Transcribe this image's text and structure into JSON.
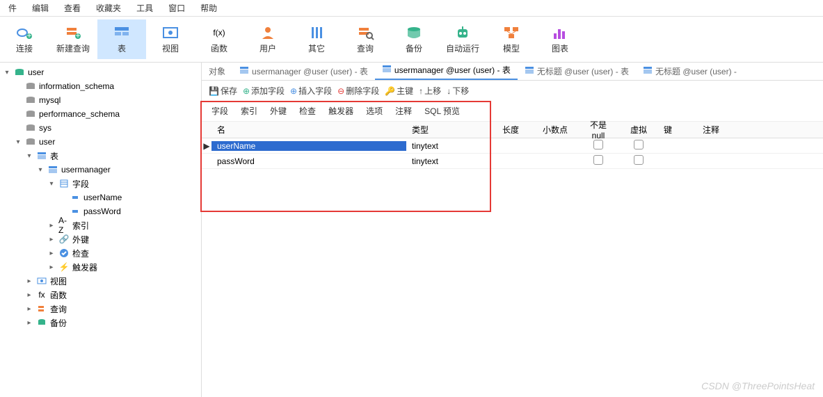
{
  "menu": [
    "文件",
    "编辑",
    "查看",
    "收藏夹",
    "工具",
    "窗口",
    "帮助"
  ],
  "toolbar": [
    {
      "label": "连接",
      "icon": "plug",
      "color": "#4a90e2"
    },
    {
      "label": "新建查询",
      "icon": "plus-doc",
      "color": "#f0803c"
    },
    {
      "label": "表",
      "icon": "table",
      "color": "#4a90e2",
      "active": true
    },
    {
      "label": "视图",
      "icon": "view",
      "color": "#4a90e2"
    },
    {
      "label": "函数",
      "icon": "fx",
      "color": "#4a90e2"
    },
    {
      "label": "用户",
      "icon": "user",
      "color": "#f0803c"
    },
    {
      "label": "其它",
      "icon": "tools",
      "color": "#4a90e2"
    },
    {
      "label": "查询",
      "icon": "query",
      "color": "#f0803c"
    },
    {
      "label": "备份",
      "icon": "backup",
      "color": "#35b38b"
    },
    {
      "label": "自动运行",
      "icon": "robot",
      "color": "#35b38b"
    },
    {
      "label": "模型",
      "icon": "model",
      "color": "#f0803c"
    },
    {
      "label": "图表",
      "icon": "chart",
      "color": "#b74de0"
    }
  ],
  "tree": [
    {
      "label": "user",
      "icon": "db-green",
      "indent": 0,
      "arrow": "▾"
    },
    {
      "label": "information_schema",
      "icon": "db",
      "indent": 1,
      "arrow": ""
    },
    {
      "label": "mysql",
      "icon": "db",
      "indent": 1,
      "arrow": ""
    },
    {
      "label": "performance_schema",
      "icon": "db",
      "indent": 1,
      "arrow": ""
    },
    {
      "label": "sys",
      "icon": "db",
      "indent": 1,
      "arrow": ""
    },
    {
      "label": "user",
      "icon": "db",
      "indent": 1,
      "arrow": "▾"
    },
    {
      "label": "表",
      "icon": "table",
      "indent": 2,
      "arrow": "▾"
    },
    {
      "label": "usermanager",
      "icon": "table",
      "indent": 3,
      "arrow": "▾"
    },
    {
      "label": "字段",
      "icon": "fields",
      "indent": 4,
      "arrow": "▾"
    },
    {
      "label": "userName",
      "icon": "field",
      "indent": 5,
      "arrow": ""
    },
    {
      "label": "passWord",
      "icon": "field",
      "indent": 5,
      "arrow": ""
    },
    {
      "label": "索引",
      "icon": "index",
      "indent": 4,
      "arrow": "▸"
    },
    {
      "label": "外键",
      "icon": "fk",
      "indent": 4,
      "arrow": "▸"
    },
    {
      "label": "检查",
      "icon": "check",
      "indent": 4,
      "arrow": "▸"
    },
    {
      "label": "触发器",
      "icon": "trigger",
      "indent": 4,
      "arrow": "▸"
    },
    {
      "label": "视图",
      "icon": "view",
      "indent": 2,
      "arrow": "▸"
    },
    {
      "label": "函数",
      "icon": "fx",
      "indent": 2,
      "arrow": "▸"
    },
    {
      "label": "查询",
      "icon": "query",
      "indent": 2,
      "arrow": "▸"
    },
    {
      "label": "备份",
      "icon": "backup",
      "indent": 2,
      "arrow": "▸"
    }
  ],
  "tabs": [
    {
      "label": "对象",
      "active": false
    },
    {
      "label": "usermanager @user (user) - 表",
      "active": false,
      "icon": "table"
    },
    {
      "label": "usermanager @user (user) - 表",
      "active": true,
      "icon": "table"
    },
    {
      "label": "无标题 @user (user) - 表",
      "active": false,
      "icon": "table"
    },
    {
      "label": "无标题 @user (user) -",
      "active": false,
      "icon": "table"
    }
  ],
  "actions": {
    "save": "保存",
    "add": "添加字段",
    "insert": "插入字段",
    "delete": "删除字段",
    "pk": "主键",
    "up": "上移",
    "down": "下移"
  },
  "subtabs": [
    "字段",
    "索引",
    "外键",
    "检查",
    "触发器",
    "选项",
    "注释",
    "SQL 预览"
  ],
  "columns": {
    "name": "名",
    "type": "类型",
    "length": "长度",
    "decimal": "小数点",
    "notnull": "不是 null",
    "virtual": "虚拟",
    "key": "键",
    "comment": "注释"
  },
  "rows": [
    {
      "name": "userName",
      "type": "tinytext",
      "selected": true
    },
    {
      "name": "passWord",
      "type": "tinytext",
      "selected": false
    }
  ],
  "watermark": "CSDN @ThreePointsHeat"
}
